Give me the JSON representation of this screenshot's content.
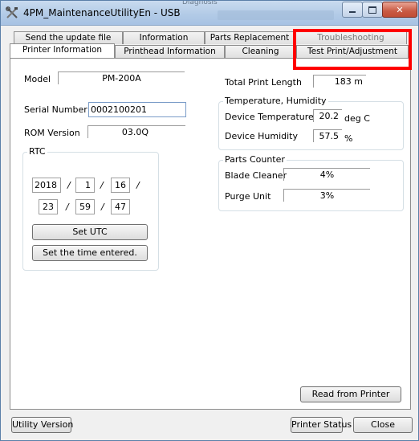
{
  "window": {
    "title": "4PM_MaintenanceUtilityEn - USB",
    "background_text": "Diagnosis"
  },
  "tabs": {
    "row_back": [
      "Send the update file",
      "Information",
      "Parts Replacement",
      "Troubleshooting"
    ],
    "row_front": [
      "Printer Information",
      "Printhead Information",
      "Cleaning",
      "Test Print/Adjustment"
    ],
    "active": "Printer Information",
    "highlighted": "Test Print/Adjustment"
  },
  "printer_info": {
    "model_label": "Model",
    "model_value": "PM-200A",
    "serial_label": "Serial Number",
    "serial_value": "0002100201",
    "rom_label": "ROM Version",
    "rom_value": "03.0Q"
  },
  "rtc": {
    "title": "RTC",
    "year": "2018",
    "month": "1",
    "day": "16",
    "hour": "23",
    "minute": "59",
    "second": "47",
    "separator": "/",
    "set_utc_label": "Set UTC",
    "set_time_label": "Set the time entered."
  },
  "print_length": {
    "label": "Total Print Length",
    "value": "183 m"
  },
  "environment": {
    "title": "Temperature, Humidity",
    "temp_label": "Device Temperature",
    "temp_value": "20.2",
    "temp_unit": "deg C",
    "humidity_label": "Device Humidity",
    "humidity_value": "57.5",
    "humidity_unit": "%"
  },
  "parts_counter": {
    "title": "Parts Counter",
    "blade_label": "Blade Cleaner",
    "blade_value": "4%",
    "purge_label": "Purge Unit",
    "purge_value": "3%"
  },
  "buttons": {
    "read_printer": "Read from Printer",
    "utility_version": "Utility Version",
    "printer_status": "Printer Status",
    "close": "Close"
  },
  "icons": {
    "app_icon": "wrench-screwdriver-icon"
  },
  "colors": {
    "highlight": "#ff0000",
    "titlebar": "#b3cbe7",
    "close_button": "#c95a43"
  }
}
